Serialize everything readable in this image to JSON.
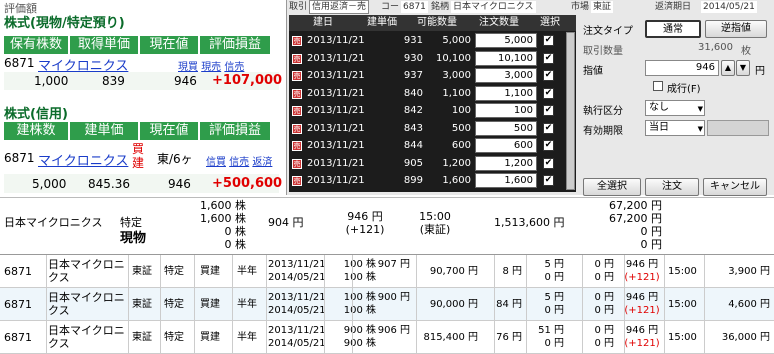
{
  "left_panel": {
    "top_label": "評価額",
    "section1_title": "株式(現物/特定預り)",
    "section1_headers": [
      "保有株数",
      "取得単価",
      "現在値",
      "評価損益"
    ],
    "section1_code": "6871",
    "section1_name": "マイクロニクス",
    "section1_links": [
      "現買",
      "現売",
      "信売"
    ],
    "section1_values": {
      "shares": "1,000",
      "cost": "839",
      "price": "946",
      "pl": "+107,000"
    },
    "section2_title": "株式(信用)",
    "section2_headers": [
      "建株数",
      "建単価",
      "現在値",
      "評価損益"
    ],
    "section2_code": "6871",
    "section2_name": "マイクロニクス",
    "section2_side_1": "買",
    "section2_side_2": "建",
    "section2_market": "東/6ヶ",
    "section2_links": [
      "信買",
      "信売",
      "返済"
    ],
    "section2_values": {
      "shares": "5,000",
      "cost": "845.36",
      "price": "946",
      "pl": "+500,600"
    }
  },
  "right_panel": {
    "tabs": [
      "取引",
      "信用返済－売",
      "コード",
      "6871",
      "銘柄",
      "日本マイクロニクス",
      "市場",
      "東証",
      "返済期日",
      "2014/05/21"
    ],
    "grid_headers": [
      "建日",
      "建単価",
      "可能数量",
      "注文数量",
      "選択"
    ],
    "rows": [
      {
        "date": "2013/11/21",
        "price": "931",
        "avail": "5,000",
        "qty": "5,000"
      },
      {
        "date": "2013/11/21",
        "price": "930",
        "avail": "10,100",
        "qty": "10,100"
      },
      {
        "date": "2013/11/21",
        "price": "937",
        "avail": "3,000",
        "qty": "3,000"
      },
      {
        "date": "2013/11/21",
        "price": "840",
        "avail": "1,100",
        "qty": "1,100"
      },
      {
        "date": "2013/11/21",
        "price": "842",
        "avail": "100",
        "qty": "100"
      },
      {
        "date": "2013/11/21",
        "price": "843",
        "avail": "500",
        "qty": "500"
      },
      {
        "date": "2013/11/21",
        "price": "844",
        "avail": "600",
        "qty": "600"
      },
      {
        "date": "2013/11/21",
        "price": "905",
        "avail": "1,200",
        "qty": "1,200"
      },
      {
        "date": "2013/11/21",
        "price": "899",
        "avail": "1,600",
        "qty": "1,600"
      }
    ],
    "order_type_label": "注文タイプ",
    "order_type_normal": "通常",
    "order_type_stop": "逆指値",
    "qty_label": "取引数量",
    "qty_value": "31,600",
    "qty_unit": "枚",
    "price_label": "指値",
    "price_value": "946",
    "price_unit": "円",
    "nari_label": "成行(F)",
    "exec_label": "執行区分",
    "exec_value": "なし",
    "expiry_label": "有効期限",
    "expiry_value": "当日",
    "select_all": "全選択",
    "order_button": "注文",
    "cancel_button": "キャンセル"
  },
  "summary": {
    "name": "日本マイクロニクス",
    "type1": "特定",
    "type2": "現物",
    "shares": [
      "1,600 株",
      "1,600 株",
      "0 株",
      "0 株"
    ],
    "cost": "904 円",
    "price": "946 円",
    "change": "(+121)",
    "time": "15:00",
    "exchange": "(東証)",
    "value": "1,513,600 円",
    "pl": [
      "67,200 円",
      "67,200 円",
      "0 円",
      "0 円"
    ]
  },
  "margin_rows": [
    {
      "code": "6871",
      "name": "日本マイクロニクス",
      "market": "東証",
      "account": "特定",
      "side": "買建",
      "term": "半年",
      "date1": "2013/11/21",
      "date2": "2014/05/21",
      "sh1": "100 株",
      "sh2": "100 株",
      "p1": "907 円",
      "p2": "",
      "amount": "90,700 円",
      "fee": "8 円",
      "c1": "5 円",
      "c2": "0 円",
      "c3": "0 円",
      "c4": "0 円",
      "price": "946 円",
      "chg": "(+121)",
      "time": "15:00",
      "pl": "3,900 円"
    },
    {
      "code": "6871",
      "name": "日本マイクロニクス",
      "market": "東証",
      "account": "特定",
      "side": "買建",
      "term": "半年",
      "date1": "2013/11/21",
      "date2": "2014/05/21",
      "sh1": "100 株",
      "sh2": "100 株",
      "p1": "900 円",
      "p2": "",
      "amount": "90,000 円",
      "fee": "84 円",
      "c1": "5 円",
      "c2": "0 円",
      "c3": "0 円",
      "c4": "0 円",
      "price": "946 円",
      "chg": "(+121)",
      "time": "15:00",
      "pl": "4,600 円"
    },
    {
      "code": "6871",
      "name": "日本マイクロニクス",
      "market": "東証",
      "account": "特定",
      "side": "買建",
      "term": "半年",
      "date1": "2013/11/21",
      "date2": "2014/05/21",
      "sh1": "900 株",
      "sh2": "900 株",
      "p1": "906 円",
      "p2": "",
      "amount": "815,400 円",
      "fee": "76 円",
      "c1": "51 円",
      "c2": "0 円",
      "c3": "0 円",
      "c4": "0 円",
      "price": "946 円",
      "chg": "(+121)",
      "time": "15:00",
      "pl": "36,000 円"
    }
  ]
}
